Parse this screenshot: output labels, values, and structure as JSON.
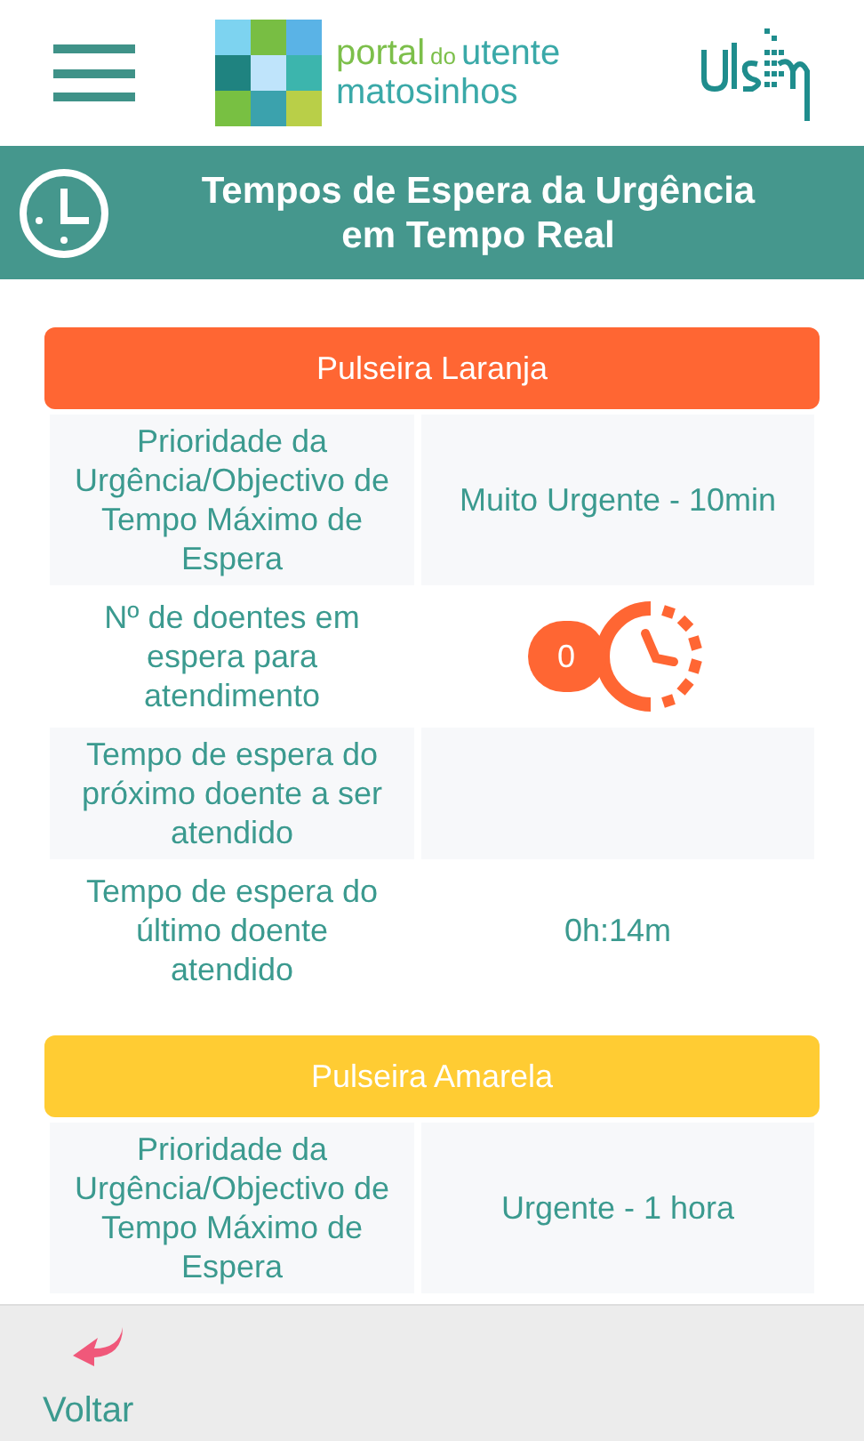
{
  "header": {
    "logo": {
      "word_1": "portal",
      "word_2": "do",
      "word_3": "utente",
      "line_2": "matosinhos"
    }
  },
  "banner": {
    "title": "Tempos de Espera da Urgência em Tempo Real"
  },
  "sections": [
    {
      "title": "Pulseira Laranja",
      "color": "#ff6633",
      "rows": [
        {
          "kind": "text",
          "label": "Prioridade da Urgência/Objectivo de Tempo Máximo de Espera",
          "value": "Muito Urgente - 10min"
        },
        {
          "kind": "count",
          "label": "Nº de doentes em espera para atendimento",
          "value": "0"
        },
        {
          "kind": "text",
          "label": "Tempo de espera do próximo doente a ser atendido"
        },
        {
          "kind": "text",
          "label": "Tempo de espera do último doente atendido",
          "value": "0h:14m"
        }
      ]
    },
    {
      "title": "Pulseira Amarela",
      "color": "#ffcc33",
      "rows": [
        {
          "kind": "text",
          "label": "Prioridade da Urgência/Objectivo de Tempo Máximo de Espera",
          "value": "Urgente - 1 hora"
        }
      ]
    }
  ],
  "footer": {
    "back": "Voltar"
  }
}
